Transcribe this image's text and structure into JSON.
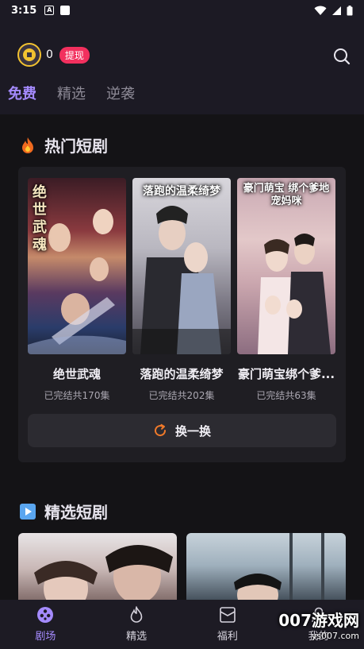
{
  "status_bar": {
    "time": "3:15",
    "a_icon_text": "A"
  },
  "header": {
    "coin_count": "0",
    "withdraw_label": "提现"
  },
  "tabs": [
    {
      "label": "免费",
      "active": true
    },
    {
      "label": "精选",
      "active": false
    },
    {
      "label": "逆袭",
      "active": false
    }
  ],
  "hot_section": {
    "title": "热门短剧",
    "items": [
      {
        "name": "绝世武魂",
        "status": "已完结共170集",
        "poster_title": "绝世武魂"
      },
      {
        "name": "落跑的温柔绮梦",
        "status": "已完结共202集",
        "poster_title": "落跑的温柔绮梦"
      },
      {
        "name": "豪门萌宝绑个爹...",
        "status": "已完结共63集",
        "poster_title": "豪门萌宝 绑个爹地宠妈咪"
      }
    ],
    "refresh_label": "换一换"
  },
  "featured_section": {
    "title": "精选短剧"
  },
  "bottom_nav": [
    {
      "label": "剧场",
      "icon": "theater-icon",
      "active": true
    },
    {
      "label": "精选",
      "icon": "flame-icon",
      "active": false
    },
    {
      "label": "福利",
      "icon": "gift-icon",
      "active": false
    },
    {
      "label": "我的",
      "icon": "profile-icon",
      "active": false
    }
  ],
  "watermark": {
    "text": "007游戏网",
    "url": "ys007.com"
  },
  "colors": {
    "accent": "#a58bff",
    "withdraw": "#f2305e",
    "coin": "#f2c230",
    "refresh_icon": "#f07a2a"
  }
}
